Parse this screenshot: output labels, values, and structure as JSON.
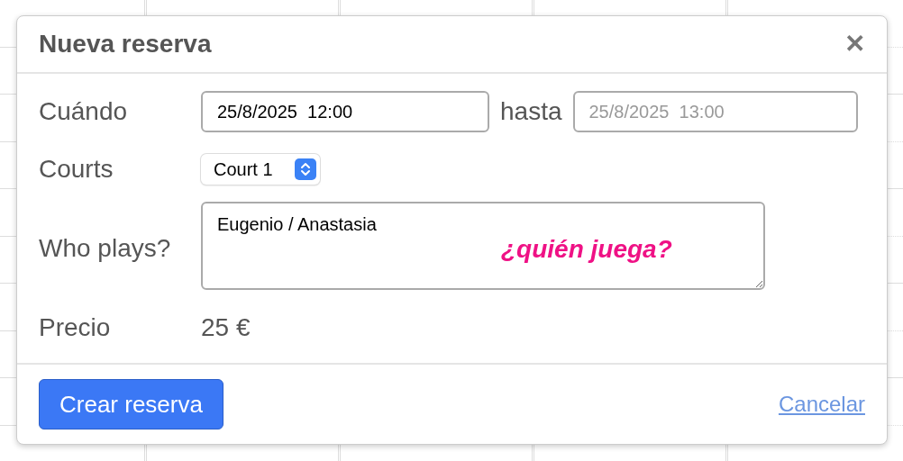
{
  "dialog": {
    "title": "Nueva reserva",
    "close": "✕"
  },
  "fields": [
    {
      "label": "Cuándo",
      "kind": "datetime_range",
      "value": "25/8/2025  12:00",
      "separator": "hasta",
      "placeholder": "25/8/2025  13:00"
    },
    {
      "label": "Courts",
      "kind": "select",
      "value": "Court 1"
    },
    {
      "label": "Who plays?",
      "kind": "textarea",
      "value": "Eugenio / Anastasia"
    },
    {
      "label": "Precio",
      "kind": "text",
      "value": "25 €"
    }
  ],
  "annotation": "¿quién juega?",
  "footer": {
    "primary": "Crear reserva",
    "cancel": "Cancelar"
  }
}
